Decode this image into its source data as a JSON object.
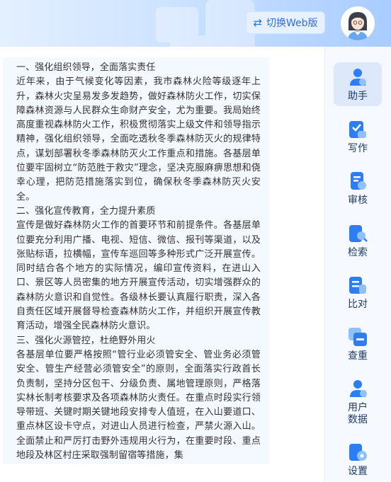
{
  "header": {
    "switch_label": "切换Web版",
    "swap_icon": "⇄"
  },
  "content": {
    "paragraphs": [
      "一、强化组织领导，全面落实责任",
      "近年来，由于气候变化等因素，我市森林火险等级逐年上升，森林火灾呈易发多发趋势，做好森林防火工作，切实保障森林资源与人民群众生命财产安全，尤为重要。我局始终高度重视森林防火工作，积极贯彻落实上级文件和领导指示精神，强化组织领导，全面吃透秋冬季森林防灭火的规律特点，谋划部署秋冬季森林防灭火工作重点和措施。各基层单位要牢固树立“防范胜于救灾”理念，坚决克服麻痹思想和侥幸心理，把防范措施落实到位，确保秋冬季森林防灭火安全。",
      "二、强化宣传教育，全力提升素质",
      "宣传是做好森林防火工作的首要环节和前提条件。各基层单位要充分利用广播、电视、短信、微信、报刊等渠道，以及张贴标语，拉横幅，宣传车巡回等多种形式广泛开展宣传。同时结合各个地方的实际情况，编印宣传资料，在进山入口、景区等人员密集的地方开展宣传活动，切实增强群众的森林防火意识和自觉性。各级林长要认真履行职责，深入各自责任区域开展督导检查森林防火工作，并组织开展宣传教育活动，增强全民森林防火意识。",
      "三、强化火源管控，杜绝野外用火",
      "各基层单位要严格按照“管行业必须管安全、管业务必须管安全、管生产经营必须管安全”的原则，全面落实行政首长负责制，坚持分区包干、分级负责、属地管理原则，严格落实林长制考核要求及各项森林防火责任。在重点时段实行领导带班、关键时期关键地段安排专人值班，在入山要道口、重点林区设卡守点，对进山人员进行检查，严禁火源入山。全面禁止和严厉打击野外违规用火行为，在重要时段、重点地段及林区村庄采取强制留宿等措施，集"
    ]
  },
  "sidebar": {
    "items": [
      {
        "label": "助手",
        "icon": "assistant-icon",
        "active": true
      },
      {
        "label": "写作",
        "icon": "writing-icon",
        "active": false
      },
      {
        "label": "审核",
        "icon": "review-icon",
        "active": false
      },
      {
        "label": "检索",
        "icon": "search-icon",
        "active": false
      },
      {
        "label": "比对",
        "icon": "compare-icon",
        "active": false
      },
      {
        "label": "查重",
        "icon": "duplicate-check-icon",
        "active": false
      },
      {
        "label": "用户\n数据",
        "icon": "user-data-icon",
        "active": false
      },
      {
        "label": "设置",
        "icon": "settings-icon",
        "active": false
      }
    ]
  },
  "colors": {
    "accent": "#2f6fd6",
    "icon_blue": "#2d7df5",
    "icon_light": "#8fc0ff",
    "sidebar_active": "#dde9fb"
  }
}
